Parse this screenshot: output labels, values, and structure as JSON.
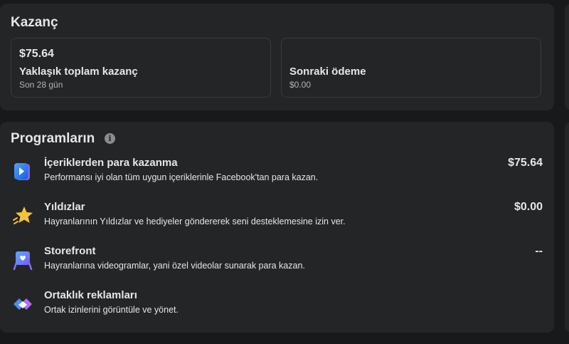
{
  "earnings": {
    "title": "Kazanç",
    "total": {
      "value": "$75.64",
      "label": "Yaklaşık toplam kazanç",
      "period": "Son 28 gün"
    },
    "next_payment": {
      "label": "Sonraki ödeme",
      "value": "$0.00"
    }
  },
  "programs": {
    "title": "Programların",
    "info_icon": "info-icon",
    "items": [
      {
        "name": "İçeriklerden para kazanma",
        "description": "Performansı iyi olan tüm uygun içeriklerinle Facebook'tan para kazan.",
        "amount": "$75.64",
        "icon": "content-monetization-icon"
      },
      {
        "name": "Yıldızlar",
        "description": "Hayranlarının Yıldızlar ve hediyeler göndererek seni desteklemesine izin ver.",
        "amount": "$0.00",
        "icon": "stars-icon"
      },
      {
        "name": "Storefront",
        "description": "Hayranlarına videogramlar, yani özel videolar sunarak para kazan.",
        "amount": "--",
        "icon": "storefront-icon"
      },
      {
        "name": "Ortaklık reklamları",
        "description": "Ortak izinlerini görüntüle ve yönet.",
        "amount": "",
        "icon": "partnership-ads-icon"
      }
    ]
  },
  "colors": {
    "background": "#18191a",
    "panel": "#242526",
    "border": "#3a3b3c",
    "text_primary": "#e4e6eb",
    "text_secondary": "#b0b3b8"
  }
}
